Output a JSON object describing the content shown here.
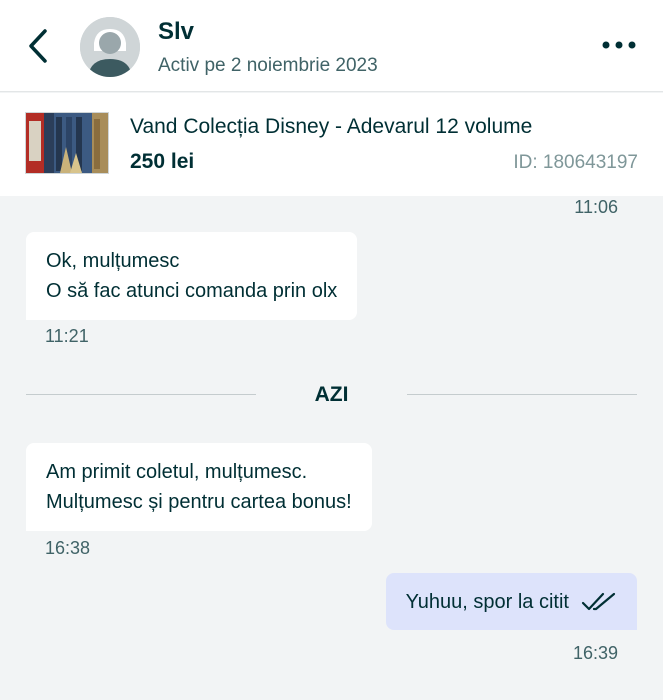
{
  "header": {
    "contact_name": "Slv",
    "status": "Activ pe 2 noiembrie 2023",
    "back_icon": "chevron-left-icon",
    "more_icon": "more-horizontal-icon"
  },
  "ad": {
    "title": "Vand Colecția Disney - Adevarul 12 volume",
    "price": "250 lei",
    "id_label": "ID: 180643197"
  },
  "messages": {
    "m0": {
      "time": "11:06"
    },
    "m1": {
      "lines": [
        "Ok, mulțumesc",
        "O să fac atunci comanda prin olx"
      ],
      "time": "11:21"
    },
    "day_separator": "AZI",
    "m2": {
      "lines": [
        "Am primit coletul, mulțumesc.",
        "Mulțumesc și pentru cartea bonus!"
      ],
      "time": "16:38"
    },
    "m3": {
      "text": "Yuhuu, spor la citit",
      "time": "16:39",
      "status_icon": "double-check-icon"
    }
  },
  "colors": {
    "background": "#f2f4f5",
    "incoming_bubble": "#ffffff",
    "outgoing_bubble": "#dde3fb",
    "text": "#002f34",
    "muted": "#406367"
  }
}
